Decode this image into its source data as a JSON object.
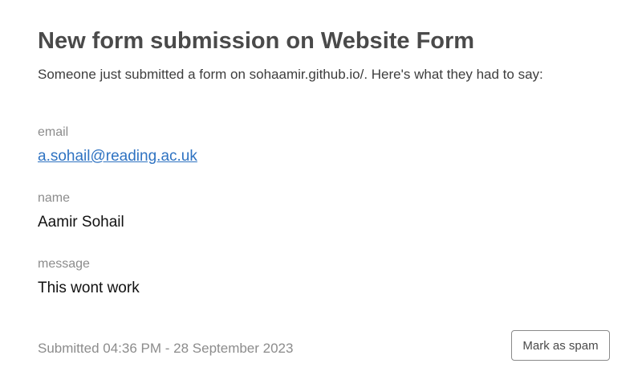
{
  "header": {
    "title": "New form submission on Website Form",
    "intro": "Someone just submitted a form on sohaamir.github.io/. Here's what they had to say:"
  },
  "fields": {
    "email": {
      "label": "email",
      "value": "a.sohail@reading.ac.uk"
    },
    "name": {
      "label": "name",
      "value": "Aamir Sohail"
    },
    "message": {
      "label": "message",
      "value": "This wont work"
    }
  },
  "footer": {
    "submitted_text": "Submitted 04:36 PM - 28 September 2023",
    "spam_button_label": "Mark as spam"
  },
  "colors": {
    "title": "#4a4a4a",
    "label": "#8c8c8c",
    "link": "#2f73c2",
    "value": "#111111"
  }
}
